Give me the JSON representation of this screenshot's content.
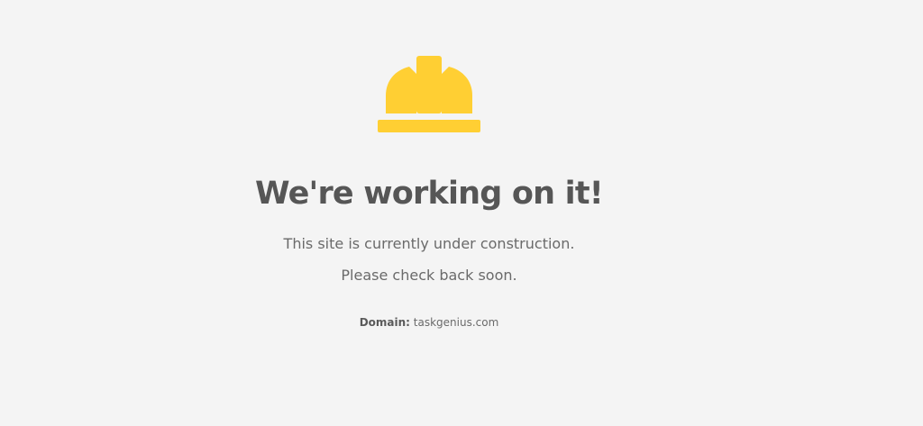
{
  "icon": {
    "name": "hard-hat-icon",
    "color": "#FFCF33"
  },
  "heading": "We're working on it!",
  "messages": [
    "This site is currently under construction.",
    "Please check back soon."
  ],
  "domain": {
    "label": "Domain:",
    "value": "taskgenius.com"
  },
  "colors": {
    "background": "#f4f4f4",
    "heading": "#565656",
    "text": "#6a6a6a"
  }
}
